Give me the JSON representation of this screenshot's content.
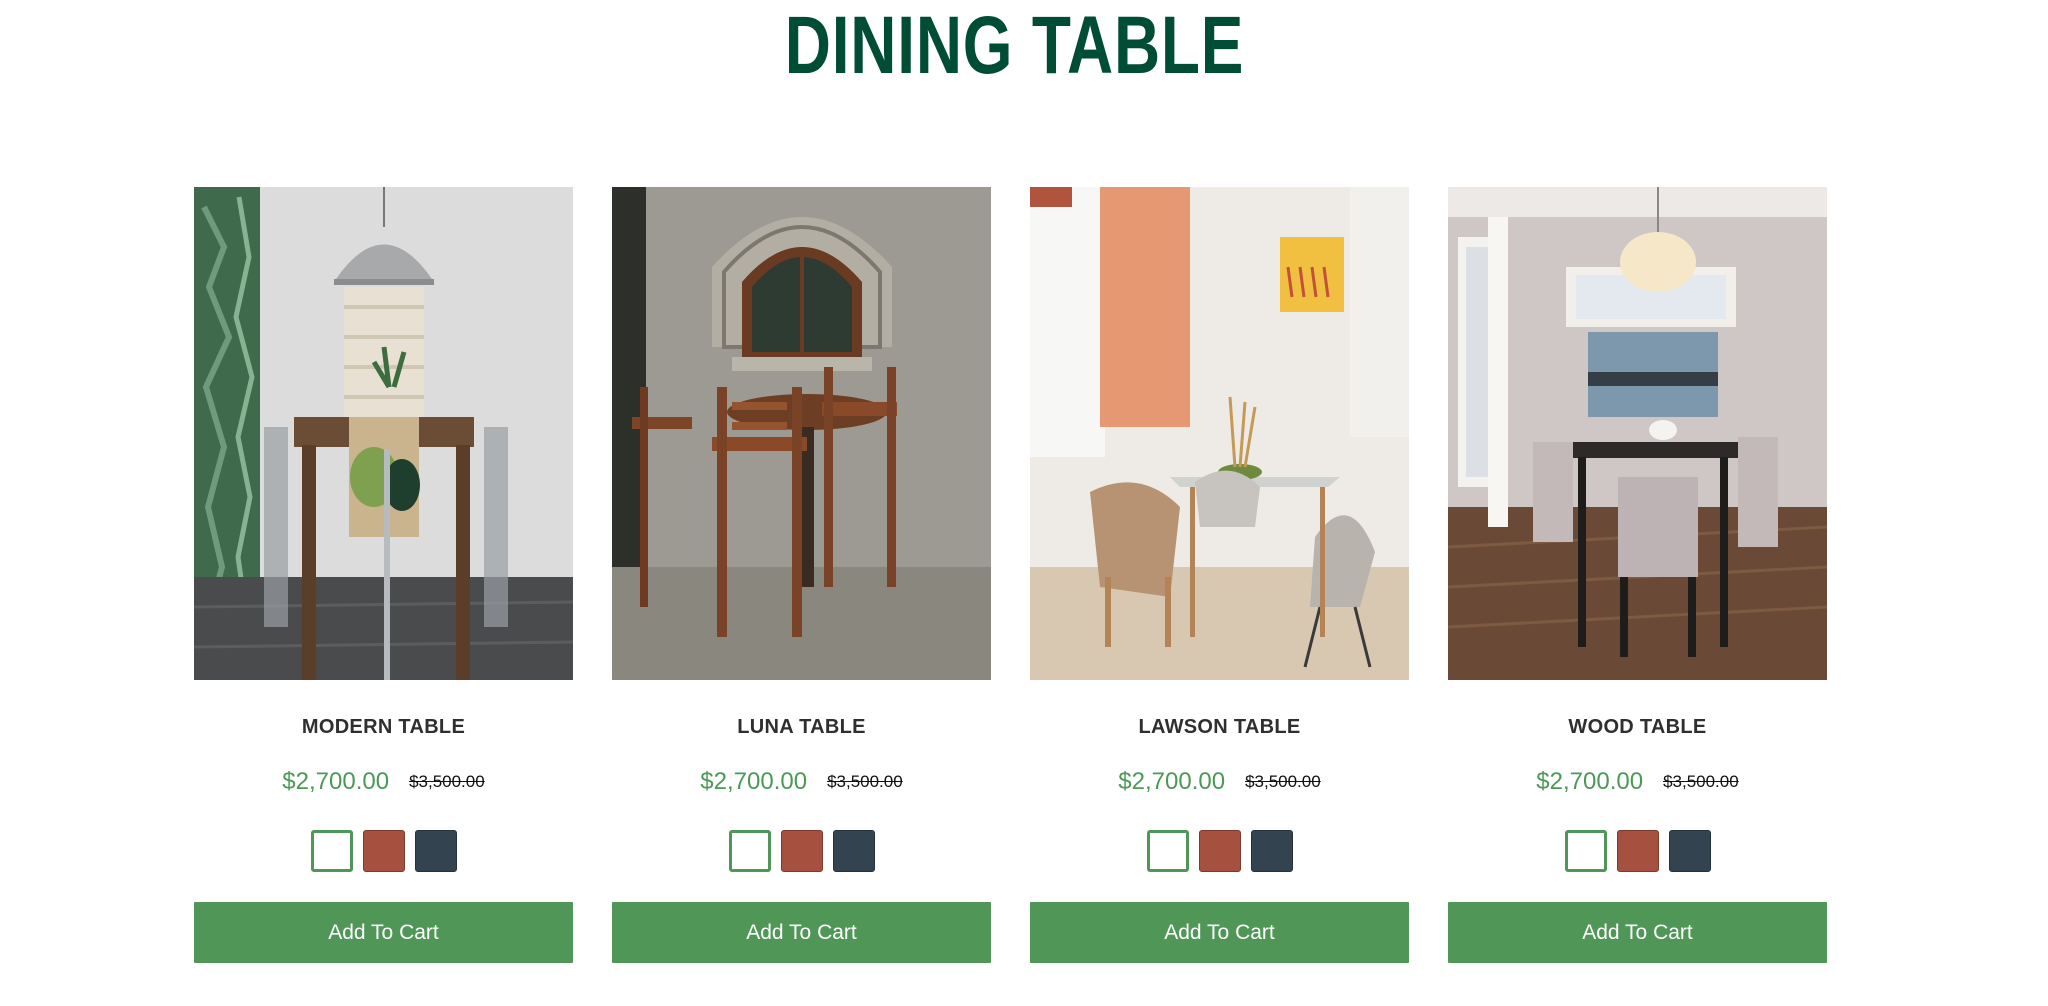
{
  "section": {
    "title": "DINING TABLE"
  },
  "colors": {
    "title": "#004d35",
    "price": "#4a9a55",
    "button": "#4f9657",
    "swatch_white": "#ffffff",
    "swatch_terracotta": "#a6503f",
    "swatch_slate": "#334450"
  },
  "products": [
    {
      "name": "MODERN TABLE",
      "price": "$2,700.00",
      "old_price": "$3,500.00",
      "swatches": [
        "white",
        "terracotta",
        "slate"
      ],
      "cart_label": "Add To Cart"
    },
    {
      "name": "LUNA TABLE",
      "price": "$2,700.00",
      "old_price": "$3,500.00",
      "swatches": [
        "white",
        "terracotta",
        "slate"
      ],
      "cart_label": "Add To Cart"
    },
    {
      "name": "LAWSON TABLE",
      "price": "$2,700.00",
      "old_price": "$3,500.00",
      "swatches": [
        "white",
        "terracotta",
        "slate"
      ],
      "cart_label": "Add To Cart"
    },
    {
      "name": "WOOD TABLE",
      "price": "$2,700.00",
      "old_price": "$3,500.00",
      "swatches": [
        "white",
        "terracotta",
        "slate"
      ],
      "cart_label": "Add To Cart"
    }
  ]
}
